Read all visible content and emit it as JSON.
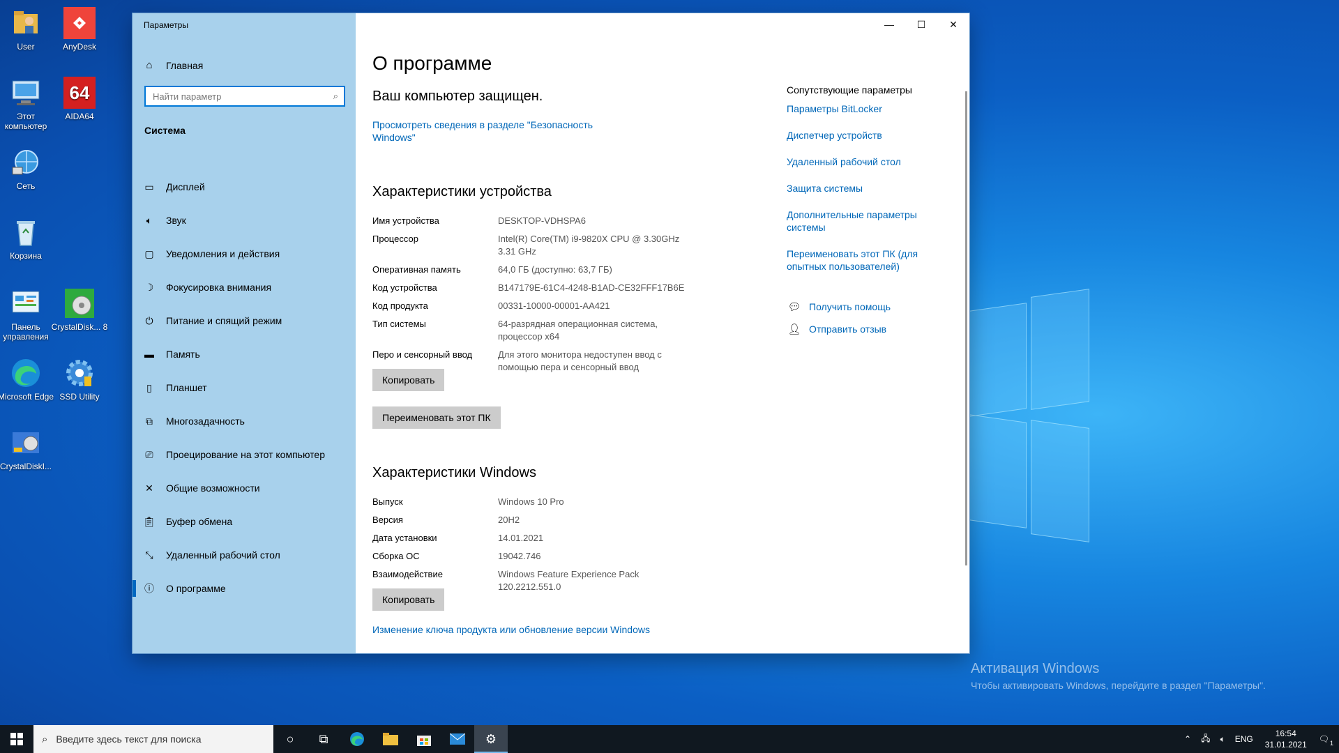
{
  "desktop": {
    "icons": [
      {
        "label": "User",
        "icon": "user-folder-icon"
      },
      {
        "label": "AnyDesk",
        "icon": "anydesk-icon"
      },
      {
        "label": "Этот компьютер",
        "icon": "computer-icon"
      },
      {
        "label": "AIDA64",
        "icon": "aida64-icon"
      },
      {
        "label": "Сеть",
        "icon": "network-icon"
      },
      {
        "label": "Корзина",
        "icon": "recycle-bin-icon"
      },
      {
        "label": "Панель управления",
        "icon": "control-panel-icon"
      },
      {
        "label": "CrystalDisk... 8",
        "icon": "crystaldisk-icon"
      },
      {
        "label": "Microsoft Edge",
        "icon": "edge-icon"
      },
      {
        "label": "SSD Utility",
        "icon": "ssd-utility-icon"
      },
      {
        "label": "CrystalDiskI...",
        "icon": "crystaldiskinfo-icon"
      }
    ],
    "activation": {
      "title": "Активация Windows",
      "text": "Чтобы активировать Windows, перейдите в раздел \"Параметры\"."
    }
  },
  "window": {
    "title": "Параметры",
    "controls": {
      "minimize": "—",
      "maximize": "☐",
      "close": "✕"
    },
    "sidebar": {
      "home_label": "Главная",
      "search_placeholder": "Найти параметр",
      "section_title": "Система",
      "items": [
        {
          "label": "Дисплей",
          "icon": "display-icon"
        },
        {
          "label": "Звук",
          "icon": "sound-icon"
        },
        {
          "label": "Уведомления и действия",
          "icon": "notifications-icon"
        },
        {
          "label": "Фокусировка внимания",
          "icon": "focus-assist-icon"
        },
        {
          "label": "Питание и спящий режим",
          "icon": "power-icon"
        },
        {
          "label": "Память",
          "icon": "storage-icon"
        },
        {
          "label": "Планшет",
          "icon": "tablet-icon"
        },
        {
          "label": "Многозадачность",
          "icon": "multitasking-icon"
        },
        {
          "label": "Проецирование на этот компьютер",
          "icon": "projecting-icon"
        },
        {
          "label": "Общие возможности",
          "icon": "shared-experiences-icon"
        },
        {
          "label": "Буфер обмена",
          "icon": "clipboard-icon"
        },
        {
          "label": "Удаленный рабочий стол",
          "icon": "remote-desktop-icon"
        },
        {
          "label": "О программе",
          "icon": "about-icon",
          "active": true
        }
      ]
    },
    "main": {
      "title": "О программе",
      "protected": "Ваш компьютер защищен.",
      "security_link": "Просмотреть сведения в разделе \"Безопасность Windows\"",
      "device_specs": {
        "heading": "Характеристики устройства",
        "rows": [
          {
            "key": "Имя устройства",
            "value": "DESKTOP-VDHSPA6"
          },
          {
            "key": "Процессор",
            "value": "Intel(R) Core(TM) i9-9820X CPU @ 3.30GHz 3.31 GHz"
          },
          {
            "key": "Оперативная память",
            "value": "64,0 ГБ (доступно: 63,7 ГБ)"
          },
          {
            "key": "Код устройства",
            "value": "B147179E-61C4-4248-B1AD-CE32FFF17B6E"
          },
          {
            "key": "Код продукта",
            "value": "00331-10000-00001-AA421"
          },
          {
            "key": "Тип системы",
            "value": "64-разрядная операционная система, процессор x64"
          },
          {
            "key": "Перо и сенсорный ввод",
            "value": "Для этого монитора недоступен ввод с помощью пера и сенсорный ввод"
          }
        ],
        "copy_button": "Копировать",
        "rename_button": "Переименовать этот ПК"
      },
      "windows_specs": {
        "heading": "Характеристики Windows",
        "rows": [
          {
            "key": "Выпуск",
            "value": "Windows 10 Pro"
          },
          {
            "key": "Версия",
            "value": "20H2"
          },
          {
            "key": "Дата установки",
            "value": "14.01.2021"
          },
          {
            "key": "Сборка ОС",
            "value": "19042.746"
          },
          {
            "key": "Взаимодействие",
            "value": "Windows Feature Experience Pack 120.2212.551.0"
          }
        ],
        "copy_button": "Копировать"
      },
      "product_key_link": "Изменение ключа продукта или обновление версии Windows"
    },
    "related": {
      "heading": "Сопутствующие параметры",
      "links": [
        "Параметры BitLocker",
        "Диспетчер устройств",
        "Удаленный рабочий стол",
        "Защита системы",
        "Дополнительные параметры системы",
        "Переименовать этот ПК (для опытных пользователей)"
      ],
      "help": {
        "label": "Получить помощь",
        "icon": "help-chat-icon"
      },
      "feedback": {
        "label": "Отправить отзыв",
        "icon": "feedback-icon"
      }
    }
  },
  "taskbar": {
    "search_placeholder": "Введите здесь текст для поиска",
    "apps": [
      {
        "name": "cortana",
        "icon": "cortana-circle-icon"
      },
      {
        "name": "task-view",
        "icon": "task-view-icon"
      },
      {
        "name": "edge",
        "icon": "edge-icon"
      },
      {
        "name": "file-explorer",
        "icon": "folder-icon"
      },
      {
        "name": "store",
        "icon": "store-icon"
      },
      {
        "name": "mail",
        "icon": "mail-icon"
      },
      {
        "name": "settings",
        "icon": "gear-icon",
        "active": true
      }
    ],
    "tray": {
      "language": "ENG",
      "time": "16:54",
      "date": "31.01.2021",
      "notification_count": "1"
    }
  },
  "colors": {
    "accent": "#0078d7",
    "link": "#0067b8",
    "sidebar_bg": "#a8d1ec",
    "taskbar_bg": "#101820"
  }
}
